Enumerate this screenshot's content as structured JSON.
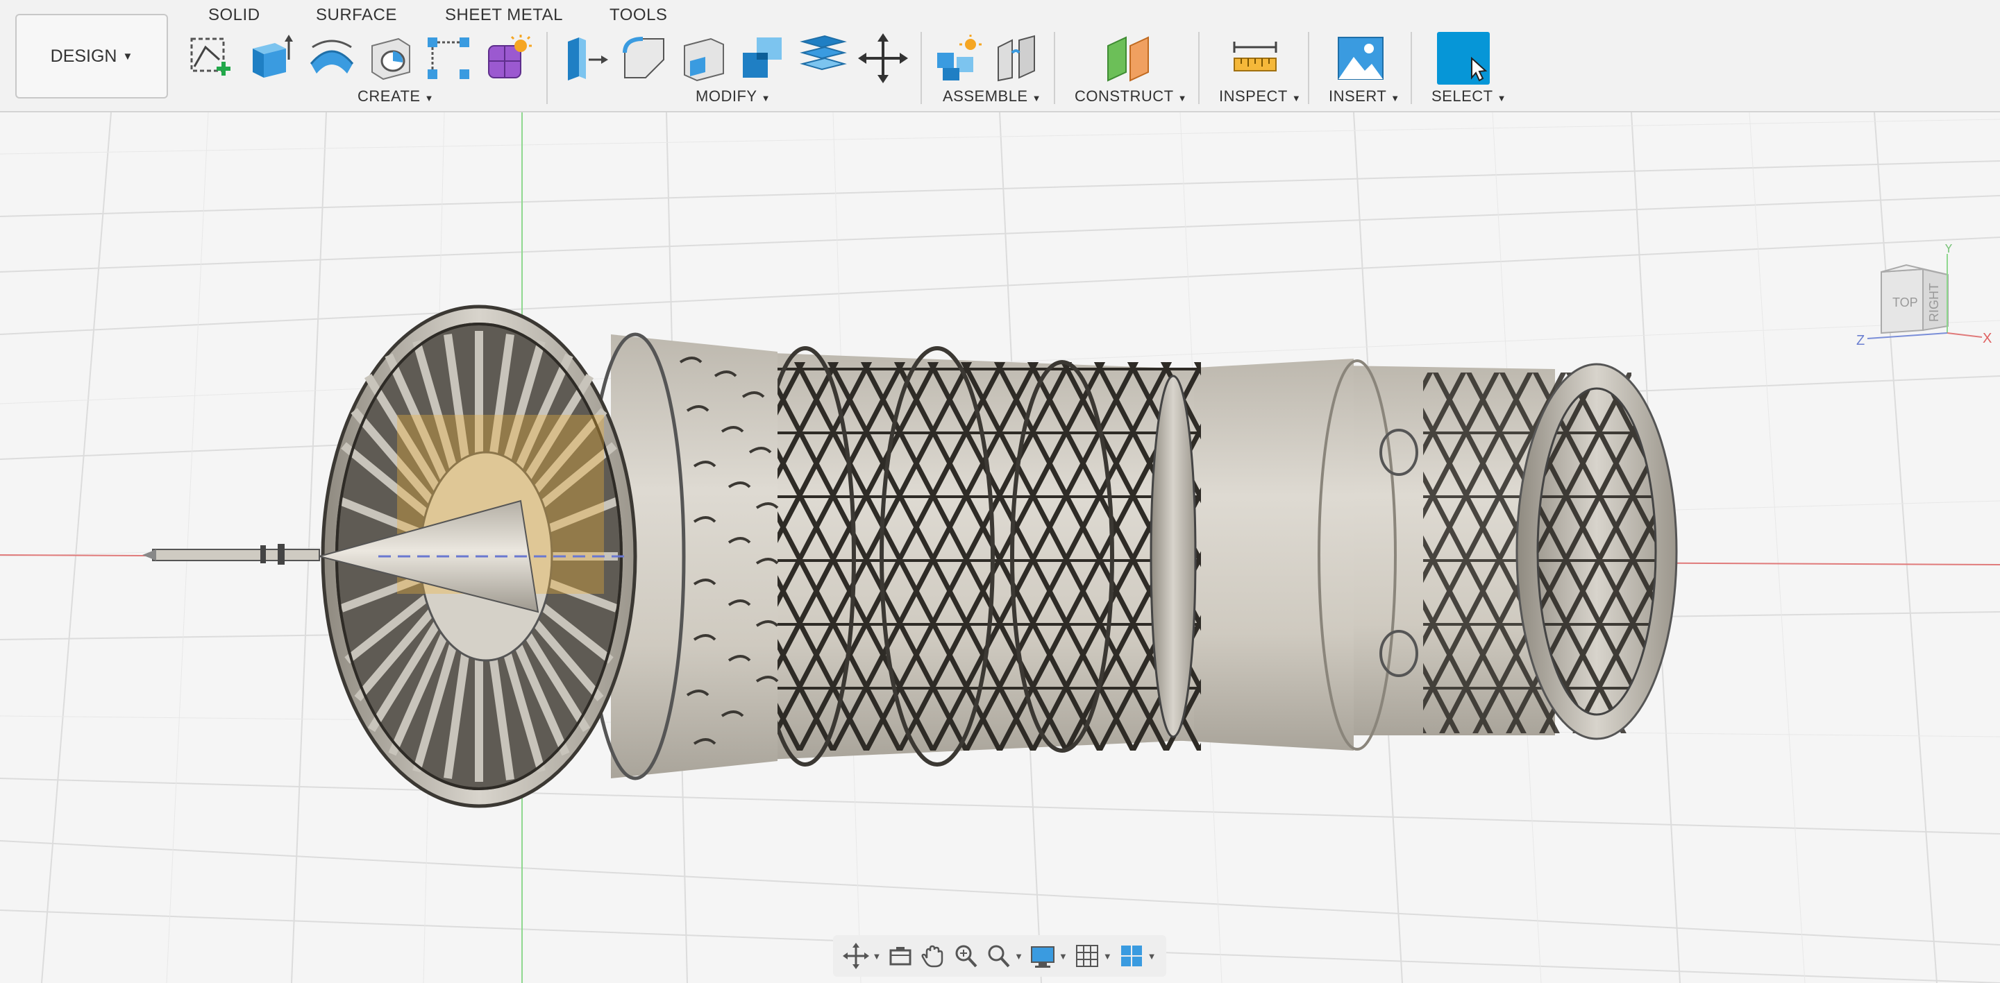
{
  "workspace": {
    "label": "DESIGN"
  },
  "tabs": [
    {
      "label": "SOLID",
      "active": true
    },
    {
      "label": "SURFACE"
    },
    {
      "label": "SHEET METAL"
    },
    {
      "label": "TOOLS"
    }
  ],
  "groups": {
    "create": "CREATE",
    "modify": "MODIFY",
    "assemble": "ASSEMBLE",
    "construct": "CONSTRUCT",
    "inspect": "INSPECT",
    "insert": "INSERT",
    "select": "SELECT"
  },
  "tools": {
    "create": [
      "create-sketch-icon",
      "extrude-icon",
      "revolve-icon",
      "hole-icon",
      "rectangular-pattern-icon",
      "create-form-icon"
    ],
    "modify": [
      "press-pull-icon",
      "fillet-icon",
      "shell-icon",
      "combine-icon",
      "offset-plane-icon",
      "move-copy-icon"
    ],
    "assemble": [
      "new-component-icon",
      "joint-icon"
    ],
    "construct": [
      "plane-icon"
    ],
    "inspect": [
      "measure-icon"
    ],
    "insert": [
      "insert-image-icon"
    ],
    "select": [
      "select-icon"
    ]
  },
  "viewcube": {
    "top": "TOP",
    "right": "RIGHT",
    "x": "X",
    "y": "Y",
    "z": "Z"
  },
  "navbar": [
    "orbit-icon",
    "look-at-icon",
    "pan-icon",
    "zoom-icon",
    "fit-icon",
    "display-settings-icon",
    "grid-settings-icon",
    "viewports-icon"
  ],
  "colors": {
    "accent": "#0696d7",
    "model": "#d9d5cc",
    "axis_x": "#e05050",
    "axis_y": "#4cc04c",
    "axis_z": "#4a6cd8"
  }
}
